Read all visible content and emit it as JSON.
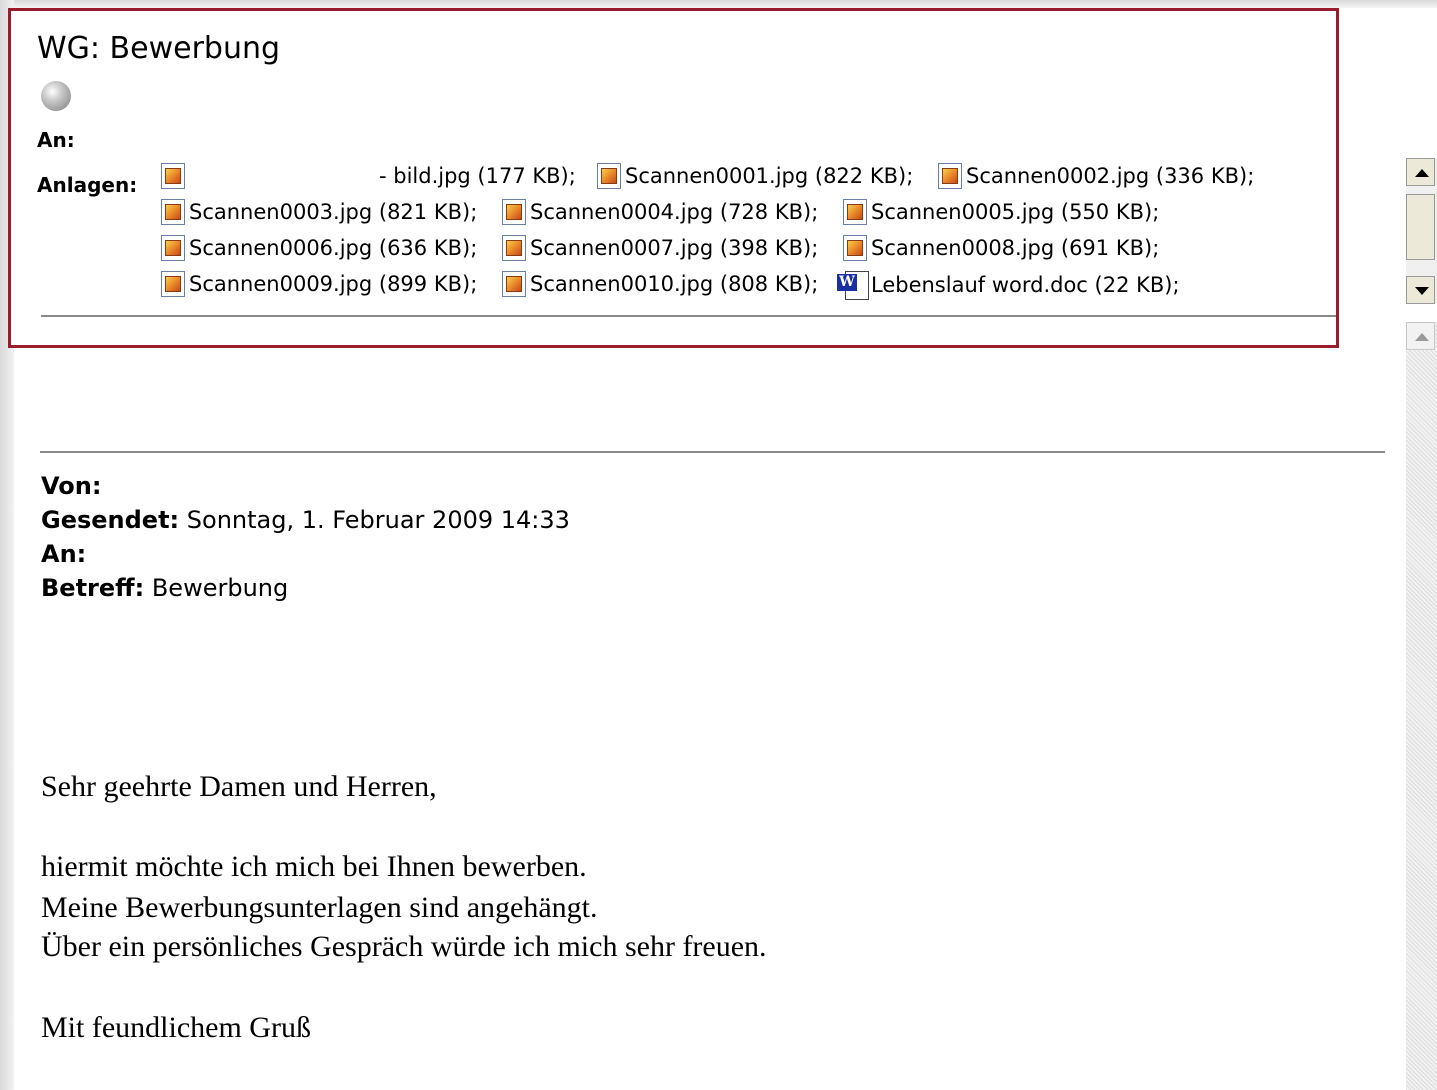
{
  "header": {
    "subject": "WG: Bewerbung",
    "to_label": "An:",
    "attachments_label": "Anlagen:",
    "attachments_rows": [
      [
        {
          "name": "- bild.jpg (177 KB);",
          "type": "image"
        },
        {
          "name": "Scannen0001.jpg (822 KB);",
          "type": "image"
        },
        {
          "name": "Scannen0002.jpg (336 KB);",
          "type": "image"
        }
      ],
      [
        {
          "name": "Scannen0003.jpg (821 KB);",
          "type": "image"
        },
        {
          "name": "Scannen0004.jpg (728 KB);",
          "type": "image"
        },
        {
          "name": "Scannen0005.jpg (550 KB);",
          "type": "image"
        }
      ],
      [
        {
          "name": "Scannen0006.jpg (636 KB);",
          "type": "image"
        },
        {
          "name": "Scannen0007.jpg (398 KB);",
          "type": "image"
        },
        {
          "name": "Scannen0008.jpg (691 KB);",
          "type": "image"
        }
      ],
      [
        {
          "name": "Scannen0009.jpg (899 KB);",
          "type": "image"
        },
        {
          "name": "Scannen0010.jpg (808 KB);",
          "type": "image"
        },
        {
          "name": "Lebenslauf word.doc (22 KB);",
          "type": "word"
        }
      ]
    ],
    "highlight_color": "#9b1b2c"
  },
  "message": {
    "from_label": "Von:",
    "sent_label": "Gesendet:",
    "sent_value": "Sonntag, 1. Februar 2009 14:33",
    "to_label": "An:",
    "subject_label": "Betreff:",
    "subject_value": "Bewerbung",
    "greeting": "Sehr geehrte Damen und Herren,",
    "lines": [
      "hiermit möchte ich mich bei Ihnen bewerben.",
      "Meine Bewerbungsunterlagen sind angehängt.",
      "Über ein persönliches Gespräch würde ich mich sehr freuen."
    ],
    "closing": "Mit feundlichem Gruß"
  },
  "icons": {
    "presence": "presence-status-icon",
    "image_attachment": "image-file-icon",
    "word_attachment": "word-document-icon",
    "scroll_up": "scroll-up-arrow-icon",
    "scroll_down": "scroll-down-arrow-icon"
  }
}
